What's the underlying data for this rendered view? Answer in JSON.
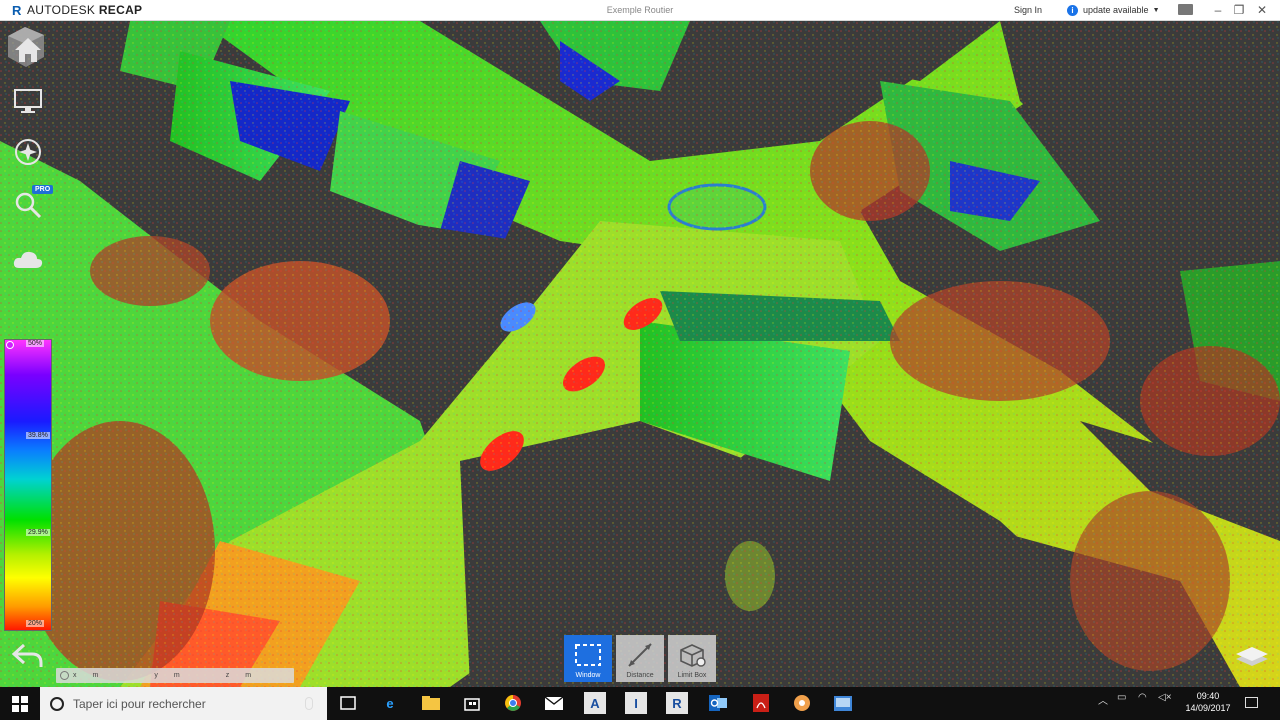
{
  "titlebar": {
    "brand_light": "AUTODESK",
    "brand_bold": "RECAP",
    "document_title": "Exemple Routier",
    "signin_label": "Sign In",
    "update_label": "update available",
    "info_glyph": "i"
  },
  "left_toolbar": {
    "icons": [
      "home-icon",
      "monitor-icon",
      "compass-icon",
      "search-icon",
      "cloud-icon"
    ],
    "pro_badge": "PRO"
  },
  "color_scale": {
    "labels": [
      "50%",
      "39.8%",
      "29.9%",
      "20%"
    ],
    "top_color": "#ff34ff",
    "bottom_color": "#ff1a00"
  },
  "coordinates": {
    "x_label": "x",
    "x_unit": "m",
    "y_label": "y",
    "y_unit": "m",
    "z_label": "z",
    "z_unit": "m"
  },
  "bottom_tools": [
    {
      "label": "Window",
      "active": true,
      "icon": "window-select-icon"
    },
    {
      "label": "Distance",
      "active": false,
      "icon": "distance-icon"
    },
    {
      "label": "Limit Box",
      "active": false,
      "icon": "limit-box-icon"
    }
  ],
  "taskbar": {
    "search_placeholder": "Taper ici pour rechercher",
    "apps": [
      "task-view-icon",
      "edge-icon",
      "file-explorer-icon",
      "store-icon",
      "chrome-icon",
      "mail-icon",
      "autodesk-a-icon",
      "autodesk-i-icon",
      "recap-icon",
      "outlook-icon",
      "acrobat-icon",
      "app-icon",
      "photos-icon"
    ],
    "app_letters": [
      "A",
      "I",
      "R"
    ],
    "time": "09:40",
    "date": "14/09/2017"
  },
  "colors": {
    "accent": "#1e6fe0",
    "brand": "#0b5eb0",
    "point_cloud_green": "#3bc43b",
    "background": "#3b3b3b"
  }
}
